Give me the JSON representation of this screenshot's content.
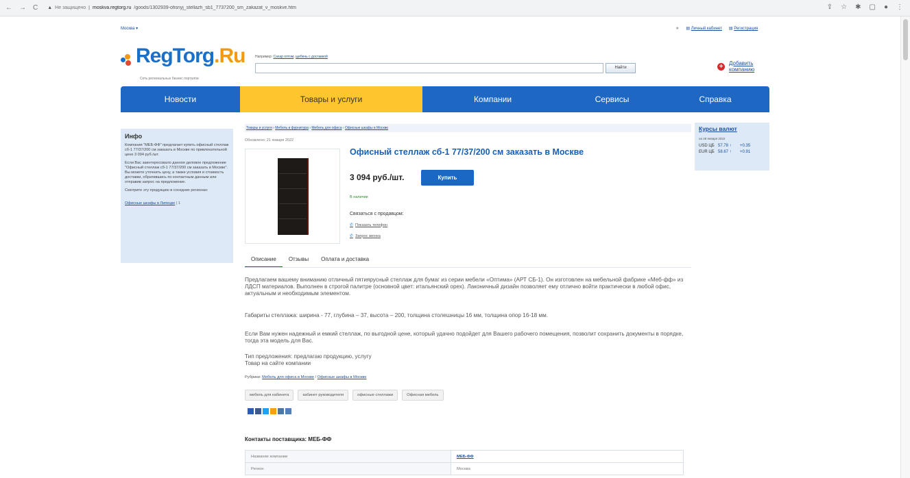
{
  "browser": {
    "security": "Не защищено",
    "url_host": "moskva.regtorg.ru",
    "url_path": "/goods/1302939-ofisnyj_stellazh_sb1_7737200_sm_zakazat_v_moskve.htm"
  },
  "top": {
    "city": "Москва ▾",
    "cabinet": "Личный кабинет",
    "register": "Регистрация"
  },
  "logo": {
    "word_a": "RegTorg",
    "word_b": ".Ru",
    "tagline": "Сеть региональных бизнес порталов"
  },
  "search": {
    "hint_prefix": "Например:",
    "hint_1": "Сахар оптом",
    "hint_2": "щебень с доставкой",
    "button": "Найти"
  },
  "add_company": "Добавить компанию",
  "nav": [
    "Новости",
    "Товары и услуги",
    "Компании",
    "Сервисы",
    "Справка"
  ],
  "info": {
    "title": "Инфо",
    "p1": "Компания \"МЕБ-ФФ\" предлагает купить офисный стеллаж сб-1 77/37/200 см заказать в Москве по привлекательной цене 3 094 руб./шт.",
    "p2": "Если Вас заинтересовало данное деловое предложение \"Офисный стеллаж сб-1 77/37/200 см заказать в Москве\". Вы можете уточнить цену, а также условия и стоимость доставки, обратившись по контактным данным или отправив запрос на предложение.",
    "p3": "Смотрите эту продукцию в соседних регионах:",
    "link": "Офисные шкафы в Липецке",
    "count": " | 1"
  },
  "currency": {
    "title": "Курсы валют",
    "date": "на 28 января 2022",
    "rows": [
      {
        "code": "USD ЦБ",
        "value": "57.78 ↑",
        "delta": "+0.35"
      },
      {
        "code": "EUR ЦБ",
        "value": "58.67 ↑",
        "delta": "+0.91"
      }
    ]
  },
  "breadcrumbs": {
    "a": "Товары и услуги",
    "b": "Мебель и фурнитура",
    "c": "Мебель для офиса",
    "d": "Офисные шкафы в Москве"
  },
  "product": {
    "updated": "Обновлено: 21 января 2022",
    "title": "Офисный стеллаж сб-1 77/37/200 см заказать в Москве",
    "price": "3 094 руб./шт.",
    "buy": "Купить",
    "stock": "В наличии",
    "contact_label": "Связаться с продавцом:",
    "show_phone": "Показать телефон",
    "call_request": "Запрос звонка"
  },
  "tabs": [
    "Описание",
    "Отзывы",
    "Оплата и доставка"
  ],
  "description": {
    "p1": "Предлагаем вашему вниманию отличный пятиярусный стеллаж для бумаг из серии мебели «Оптима» (АРТ СБ-1). Он изготовлен на мебельной фабрике «Меб-фф» из ЛДСП материалов. Выполнен в строгой палитре (основной цвет: итальянский орех). Лаконичный дизайн позволяет ему отлично войти практически в любой офис, актуальным и необходимым элементом.",
    "p2": "Габариты стеллажа: ширина - 77, глубина – 37, высота – 200, толщина столешницы 16 мм, толщина опор 16-18 мм.",
    "p3": "Если Вам нужен надежный и емкий стеллаж, по выгодной цене, который удачно подойдет для Вашего рабочего помещения, позволит сохранить документы в порядке, тогда эта модель для Вас.",
    "p4": "Тип предложения: предлагаю продукцию, услугу",
    "p5": "Товар на сайте компании"
  },
  "rubrics": {
    "label": "Рубрики:",
    "r1": "Мебель для офиса в Москве",
    "sep": " / ",
    "r2": "Офисные шкафы в Москве"
  },
  "tags": [
    "мебель для кабинета",
    "кабинет руководителя",
    "офисные стеллажи",
    "Офисная мебель"
  ],
  "social_colors": [
    "#2a5db0",
    "#3b5998",
    "#1da1f2",
    "#f2a20c",
    "#4a76a8",
    "#5181b8"
  ],
  "contacts": {
    "title": "Контакты поставщика: МЕБ-ФФ",
    "rows": [
      {
        "k": "Название компании",
        "v": "МЕБ-ФФ"
      },
      {
        "k": "Регион",
        "v": "Москва"
      }
    ]
  }
}
